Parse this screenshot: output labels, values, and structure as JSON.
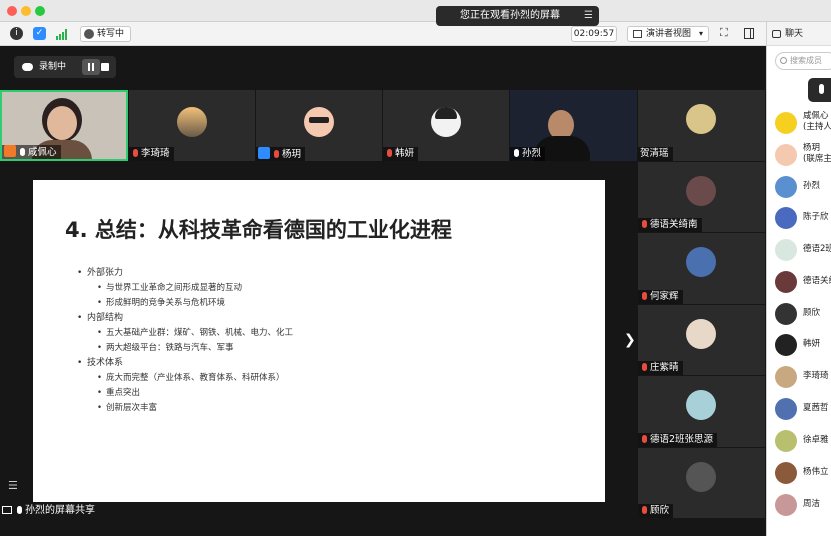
{
  "banner": {
    "text": "您正在观看孙烈的屏幕"
  },
  "toolbar": {
    "transcribe_label": "转写中",
    "timer": "02:09:57",
    "view_label": "演讲者视图"
  },
  "recording": {
    "label": "录制中"
  },
  "participants": [
    {
      "name": "咸佩心"
    },
    {
      "name": "李琦琦"
    },
    {
      "name": "杨玥"
    },
    {
      "name": "韩妍"
    },
    {
      "name": "孙烈"
    },
    {
      "name": "贺清瑶"
    },
    {
      "name": "德语关绮南"
    },
    {
      "name": "何家辉"
    },
    {
      "name": "庄紫晴"
    },
    {
      "name": "德语2班张思源"
    },
    {
      "name": "顾欣"
    }
  ],
  "slide": {
    "title": "4. 总结：从科技革命看德国的工业化进程",
    "sections": [
      {
        "heading": "外部张力",
        "items": [
          "与世界工业革命之间形成显著的互动",
          "形成鲜明的竞争关系与危机环境"
        ]
      },
      {
        "heading": "内部结构",
        "items": [
          "五大基础产业群：煤矿、钢铁、机械、电力、化工",
          "两大超级平台：铁路与汽车、军事"
        ]
      },
      {
        "heading": "技术体系",
        "items": [
          "庞大而完整（产业体系、教育体系、科研体系）",
          "重点突出",
          "创新层次丰富"
        ]
      }
    ]
  },
  "share_label": "孙烈的屏幕共享",
  "panel": {
    "title": "聊天",
    "search_placeholder": "搜索成员",
    "members": [
      {
        "name": "咸佩心",
        "sub": "(主持人"
      },
      {
        "name": "杨玥",
        "sub": "(联席主"
      },
      {
        "name": "孙烈",
        "sub": ""
      },
      {
        "name": "陈子欣",
        "sub": ""
      },
      {
        "name": "德语2班",
        "sub": ""
      },
      {
        "name": "德语关绮",
        "sub": ""
      },
      {
        "name": "顾欣",
        "sub": ""
      },
      {
        "name": "韩妍",
        "sub": ""
      },
      {
        "name": "李琦琦",
        "sub": ""
      },
      {
        "name": "夏茜哲",
        "sub": ""
      },
      {
        "name": "徐卓雅",
        "sub": ""
      },
      {
        "name": "杨伟立",
        "sub": ""
      },
      {
        "name": "周洁",
        "sub": ""
      }
    ]
  }
}
